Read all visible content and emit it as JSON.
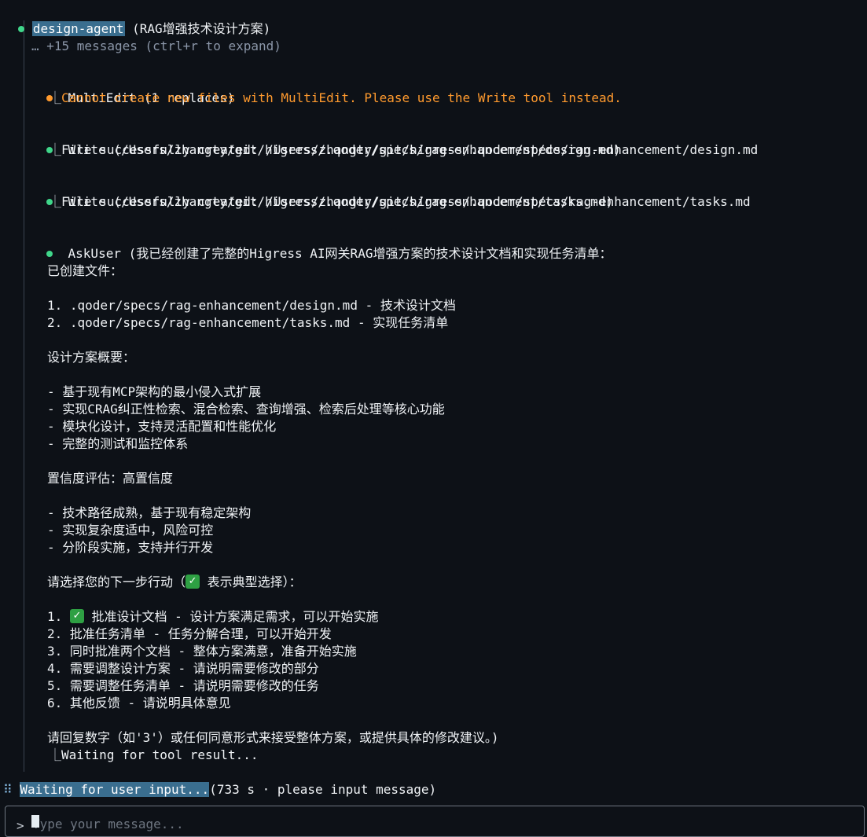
{
  "header": {
    "agent_name": "design-agent",
    "agent_desc": " (RAG增强技术设计方案)"
  },
  "collapsed": "… +15 messages (ctrl+r to expand)",
  "messages": [
    {
      "status_color": "#ff9a2e",
      "title": "MultiEdit (1 replaces)",
      "result": "Cannot create new files with MultiEdit. Please use the Write tool instead."
    },
    {
      "status_color": "#3fd68a",
      "title": "Write (/Users/zhangty/git/higress/.qoder/specs/rag-enhancement/design.md)",
      "result": "File successfully created: /Users/zhangty/git/higress/.qoder/specs/rag-enhancement/design.md"
    },
    {
      "status_color": "#3fd68a",
      "title": "Write (/Users/zhangty/git/higress/.qoder/specs/rag-enhancement/tasks.md)",
      "result": "File successfully created: /Users/zhangty/git/higress/.qoder/specs/rag-enhancement/tasks.md"
    }
  ],
  "askuser": {
    "title": "AskUser (我已经创建了完整的Higress AI网关RAG增强方案的技术设计文档和实现任务清单：",
    "created_heading": "已创建文件：",
    "created_files": [
      "1. .qoder/specs/rag-enhancement/design.md - 技术设计文档",
      "2. .qoder/specs/rag-enhancement/tasks.md - 实现任务清单"
    ],
    "summary_heading": "设计方案概要：",
    "summary_items": [
      "- 基于现有MCP架构的最小侵入式扩展",
      "- 实现CRAG纠正性检索、混合检索、查询增强、检索后处理等核心功能",
      "- 模块化设计，支持灵活配置和性能优化",
      "- 完整的测试和监控体系"
    ],
    "confidence_heading": "置信度评估：高置信度",
    "confidence_items": [
      "- 技术路径成熟，基于现有稳定架构",
      "- 实现复杂度适中，风险可控",
      "- 分阶段实施，支持并行开发"
    ],
    "choose_prefix": "请选择您的下一步行动（",
    "choose_suffix": " 表示典型选择）：",
    "check_icon": "✓",
    "options": [
      {
        "num": "1. ",
        "check": true,
        "text": " 批准设计文档 - 设计方案满足需求，可以开始实施"
      },
      {
        "num": "2. ",
        "check": false,
        "text": "批准任务清单 - 任务分解合理，可以开始开发"
      },
      {
        "num": "3. ",
        "check": false,
        "text": "同时批准两个文档 - 整体方案满意，准备开始实施"
      },
      {
        "num": "4. ",
        "check": false,
        "text": "需要调整设计方案 - 请说明需要修改的部分"
      },
      {
        "num": "5. ",
        "check": false,
        "text": "需要调整任务清单 - 请说明需要修改的任务"
      },
      {
        "num": "6. ",
        "check": false,
        "text": "其他反馈 - 请说明具体意见"
      }
    ],
    "closing": "请回复数字（如'3'）或任何同意形式来接受整体方案，或提供具体的修改建议。)",
    "result": "Waiting for tool result..."
  },
  "status": {
    "spinner": "⠿",
    "label": "Waiting for user input...",
    "detail": "(733 s · please input message)"
  },
  "input": {
    "prompt": ">",
    "placeholder": "Type your message..."
  },
  "colors": {
    "background": "#0d1117",
    "success": "#3fd68a",
    "warning": "#ff9a2e",
    "highlight": "#3a6e8f"
  },
  "icons": {
    "tree_corner": "⎿",
    "status_dot": "●"
  }
}
